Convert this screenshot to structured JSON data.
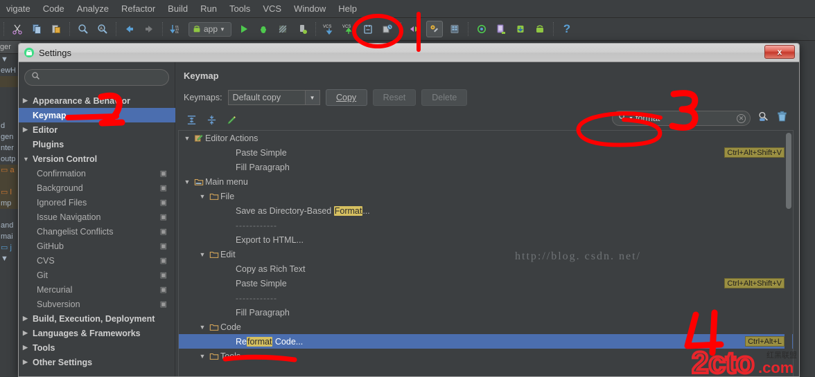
{
  "ide": {
    "menu_items": [
      {
        "label": "vigate"
      },
      {
        "label": "Code"
      },
      {
        "label": "Analyze"
      },
      {
        "label": "Refactor"
      },
      {
        "label": "Build"
      },
      {
        "label": "Run"
      },
      {
        "label": "Tools"
      },
      {
        "label": "VCS"
      },
      {
        "label": "Window"
      },
      {
        "label": "Help"
      }
    ],
    "toolbar": {
      "run_config_label": "app",
      "icons": [
        "cut-icon",
        "copy-icon",
        "paste-icon",
        "find-icon",
        "replace-icon",
        "back-icon",
        "forward-icon",
        "sync-icon",
        "android-run-config-icon",
        "run-icon",
        "debug-icon",
        "coverage-icon",
        "run-device-icon",
        "vcs-update-icon",
        "vcs-commit-icon",
        "vcs-history-icon",
        "vcs-changes-icon",
        "compare-icon",
        "sdk-manager-icon",
        "avd-manager-icon",
        "gradle-sync-icon",
        "device-monitor-icon",
        "sdk-download-icon",
        "android-icon",
        "help-icon"
      ],
      "help_label": "?"
    },
    "left_panel_fragments": [
      "ger",
      "▼",
      "ewH",
      "",
      "",
      "d",
      "gen",
      "nter",
      "outp",
      "a",
      "",
      "l",
      "mp",
      "",
      "and",
      "mai",
      "j",
      "▼"
    ]
  },
  "dialog": {
    "title": "Settings",
    "title_icon": "android-studio-icon",
    "close_label": "x",
    "sidebar": {
      "search_placeholder": "",
      "search_value": "",
      "search_icon": "search-icon",
      "items": [
        {
          "label": "Appearance & Behavior",
          "arrow": "▶",
          "bold": true,
          "child": false,
          "copy": false,
          "selected": false
        },
        {
          "label": "Keymap",
          "arrow": "",
          "bold": true,
          "child": false,
          "copy": false,
          "selected": true
        },
        {
          "label": "Editor",
          "arrow": "▶",
          "bold": true,
          "child": false,
          "copy": false,
          "selected": false
        },
        {
          "label": "Plugins",
          "arrow": "",
          "bold": true,
          "child": false,
          "copy": false,
          "selected": false
        },
        {
          "label": "Version Control",
          "arrow": "▼",
          "bold": true,
          "child": false,
          "copy": false,
          "selected": false
        },
        {
          "label": "Confirmation",
          "arrow": "",
          "bold": false,
          "child": true,
          "copy": true,
          "selected": false
        },
        {
          "label": "Background",
          "arrow": "",
          "bold": false,
          "child": true,
          "copy": true,
          "selected": false
        },
        {
          "label": "Ignored Files",
          "arrow": "",
          "bold": false,
          "child": true,
          "copy": true,
          "selected": false
        },
        {
          "label": "Issue Navigation",
          "arrow": "",
          "bold": false,
          "child": true,
          "copy": true,
          "selected": false
        },
        {
          "label": "Changelist Conflicts",
          "arrow": "",
          "bold": false,
          "child": true,
          "copy": true,
          "selected": false
        },
        {
          "label": "GitHub",
          "arrow": "",
          "bold": false,
          "child": true,
          "copy": true,
          "selected": false
        },
        {
          "label": "CVS",
          "arrow": "",
          "bold": false,
          "child": true,
          "copy": true,
          "selected": false
        },
        {
          "label": "Git",
          "arrow": "",
          "bold": false,
          "child": true,
          "copy": true,
          "selected": false
        },
        {
          "label": "Mercurial",
          "arrow": "",
          "bold": false,
          "child": true,
          "copy": true,
          "selected": false
        },
        {
          "label": "Subversion",
          "arrow": "",
          "bold": false,
          "child": true,
          "copy": true,
          "selected": false
        },
        {
          "label": "Build, Execution, Deployment",
          "arrow": "▶",
          "bold": true,
          "child": false,
          "copy": false,
          "selected": false
        },
        {
          "label": "Languages & Frameworks",
          "arrow": "▶",
          "bold": true,
          "child": false,
          "copy": false,
          "selected": false
        },
        {
          "label": "Tools",
          "arrow": "▶",
          "bold": true,
          "child": false,
          "copy": false,
          "selected": false
        },
        {
          "label": "Other Settings",
          "arrow": "▶",
          "bold": true,
          "child": false,
          "copy": false,
          "selected": false
        }
      ]
    },
    "panel": {
      "heading": "Keymap",
      "keymaps_label": "Keymaps:",
      "keymap_selected": "Default copy",
      "copy_button": "Copy",
      "reset_button": "Reset",
      "delete_button": "Delete",
      "mini_tools": [
        "expand-all-icon",
        "collapse-all-icon",
        "edit-shortcut-icon"
      ],
      "search": {
        "value": "format",
        "search_icon": "search-icon",
        "clear_icon": "clear-icon",
        "find_actions_icon": "find-by-shortcut-icon",
        "reset_icon": "trash-icon"
      }
    },
    "tree": {
      "highlight_term": "format",
      "rows": [
        {
          "indent": 0,
          "twisty": "▼",
          "icon": "editor-actions-icon",
          "text": "Editor Actions",
          "shortcut": "",
          "selected": false,
          "type": "group"
        },
        {
          "indent": 2,
          "twisty": "",
          "icon": "",
          "text": "Paste Simple",
          "shortcut": "Ctrl+Alt+Shift+V",
          "selected": false,
          "type": "action"
        },
        {
          "indent": 2,
          "twisty": "",
          "icon": "",
          "text": "Fill Paragraph",
          "shortcut": "",
          "selected": false,
          "type": "action"
        },
        {
          "indent": 0,
          "twisty": "▼",
          "icon": "main-menu-icon",
          "text": "Main menu",
          "shortcut": "",
          "selected": false,
          "type": "group"
        },
        {
          "indent": 1,
          "twisty": "▼",
          "icon": "folder-icon",
          "text": "File",
          "shortcut": "",
          "selected": false,
          "type": "group"
        },
        {
          "indent": 2,
          "twisty": "",
          "icon": "",
          "text": "Save as Directory-Based Format...",
          "shortcut": "",
          "selected": false,
          "type": "action"
        },
        {
          "indent": 2,
          "twisty": "",
          "icon": "",
          "text": "------------",
          "shortcut": "",
          "selected": false,
          "type": "separator"
        },
        {
          "indent": 2,
          "twisty": "",
          "icon": "",
          "text": "Export to HTML...",
          "shortcut": "",
          "selected": false,
          "type": "action"
        },
        {
          "indent": 1,
          "twisty": "▼",
          "icon": "folder-icon",
          "text": "Edit",
          "shortcut": "",
          "selected": false,
          "type": "group"
        },
        {
          "indent": 2,
          "twisty": "",
          "icon": "",
          "text": "Copy as Rich Text",
          "shortcut": "",
          "selected": false,
          "type": "action"
        },
        {
          "indent": 2,
          "twisty": "",
          "icon": "",
          "text": "Paste Simple",
          "shortcut": "Ctrl+Alt+Shift+V",
          "selected": false,
          "type": "action"
        },
        {
          "indent": 2,
          "twisty": "",
          "icon": "",
          "text": "------------",
          "shortcut": "",
          "selected": false,
          "type": "separator"
        },
        {
          "indent": 2,
          "twisty": "",
          "icon": "",
          "text": "Fill Paragraph",
          "shortcut": "",
          "selected": false,
          "type": "action"
        },
        {
          "indent": 1,
          "twisty": "▼",
          "icon": "folder-icon",
          "text": "Code",
          "shortcut": "",
          "selected": false,
          "type": "group"
        },
        {
          "indent": 2,
          "twisty": "",
          "icon": "",
          "text": "Reformat Code...",
          "shortcut": "Ctrl+Alt+L",
          "selected": true,
          "type": "action"
        },
        {
          "indent": 1,
          "twisty": "▼",
          "icon": "folder-icon",
          "text": "Tools",
          "shortcut": "",
          "selected": false,
          "type": "group"
        }
      ]
    },
    "watermark": "http://blog. csdn. net/"
  },
  "annotations": {
    "color": "#ff0000",
    "marks": [
      {
        "name": "circle-sdk-manager",
        "label": ""
      },
      {
        "name": "vertical-stroke",
        "label": ""
      },
      {
        "name": "number-1-underline",
        "label": ""
      },
      {
        "name": "number-2",
        "label": "2"
      },
      {
        "name": "number-3",
        "label": "3"
      },
      {
        "name": "circle-search-field",
        "label": ""
      },
      {
        "name": "number-4",
        "label": "4"
      },
      {
        "name": "underline-reformat-code",
        "label": ""
      }
    ]
  },
  "logo": {
    "text": "2cto",
    "suffix": ".com",
    "cn_text": "红黑联盟",
    "color": "#e8262c"
  }
}
